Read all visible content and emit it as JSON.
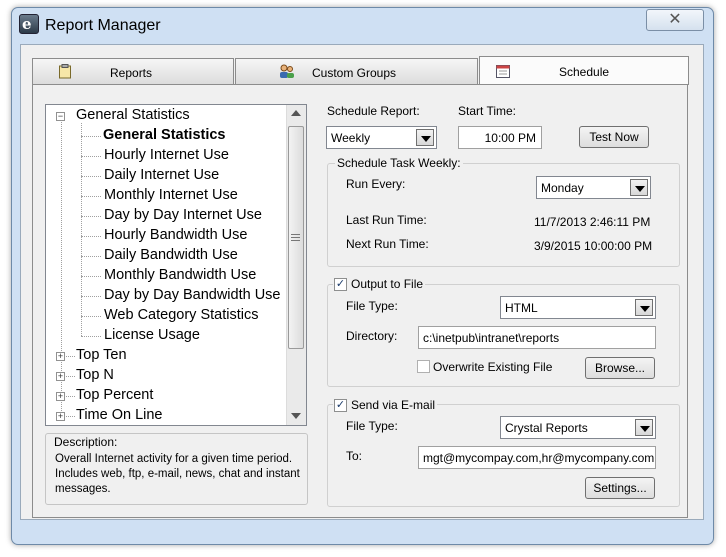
{
  "window": {
    "title": "Report Manager",
    "close_symbol": "✕"
  },
  "tabs": [
    {
      "label": "Reports",
      "icon": "clipboard-icon"
    },
    {
      "label": "Custom Groups",
      "icon": "users-icon"
    },
    {
      "label": "Schedule",
      "icon": "calendar-icon"
    }
  ],
  "active_tab": "Schedule",
  "tree": {
    "root_label": "General Statistics",
    "children": [
      "General Statistics",
      "Hourly Internet Use",
      "Daily Internet Use",
      "Monthly Internet Use",
      "Day by Day Internet Use",
      "Hourly Bandwidth Use",
      "Daily Bandwidth Use",
      "Monthly Bandwidth Use",
      "Day by Day Bandwidth Use",
      "Web Category Statistics",
      "License Usage"
    ],
    "selected": "General Statistics",
    "collapsed": [
      "Top Ten",
      "Top N",
      "Top Percent",
      "Time On Line"
    ]
  },
  "description": {
    "title": "Description:",
    "text": "Overall Internet activity for a given time period.  Includes web, ftp, e-mail, news, chat and instant messages."
  },
  "schedule": {
    "schedule_report_label": "Schedule Report:",
    "schedule_report_value": "Weekly",
    "start_time_label": "Start Time:",
    "start_time_value": "10:00 PM",
    "test_now_label": "Test Now"
  },
  "weekly": {
    "group_title": "Schedule Task Weekly:",
    "run_every_label": "Run Every:",
    "run_every_value": "Monday",
    "last_run_label": "Last Run Time:",
    "last_run_value": "11/7/2013 2:46:11 PM",
    "next_run_label": "Next Run Time:",
    "next_run_value": "3/9/2015 10:00:00 PM"
  },
  "output": {
    "group_title": "Output to File",
    "checked": true,
    "file_type_label": "File Type:",
    "file_type_value": "HTML",
    "directory_label": "Directory:",
    "directory_value": "c:\\inetpub\\intranet\\reports",
    "overwrite_label": "Overwrite Existing File",
    "overwrite_checked": false,
    "browse_label": "Browse..."
  },
  "email": {
    "group_title": "Send via E-mail",
    "checked": true,
    "file_type_label": "File Type:",
    "file_type_value": "Crystal Reports",
    "to_label": "To:",
    "to_value": "mgt@mycompay.com,hr@mycompany.com",
    "settings_label": "Settings..."
  }
}
